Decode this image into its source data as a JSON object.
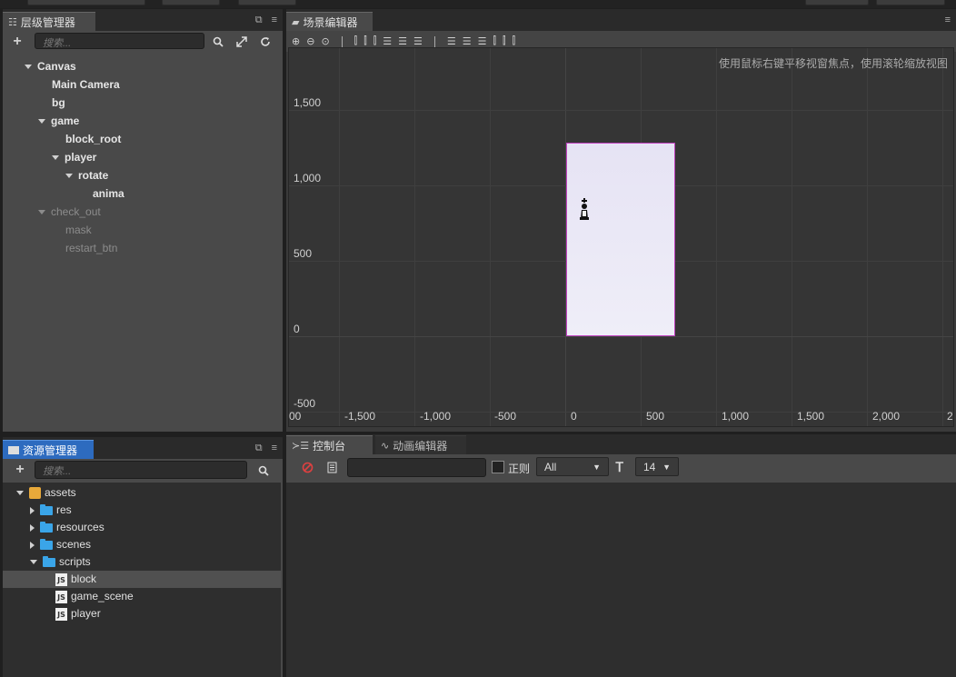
{
  "hierarchy": {
    "title": "层级管理器",
    "search_placeholder": "搜索...",
    "nodes": [
      {
        "label": "Canvas",
        "expanded": true,
        "dim": false
      },
      {
        "label": "Main Camera",
        "dim": false
      },
      {
        "label": "bg",
        "dim": false
      },
      {
        "label": "game",
        "expanded": true,
        "dim": false
      },
      {
        "label": "block_root",
        "dim": false
      },
      {
        "label": "player",
        "expanded": true,
        "dim": false
      },
      {
        "label": "rotate",
        "expanded": true,
        "dim": false
      },
      {
        "label": "anima",
        "dim": false
      },
      {
        "label": "check_out",
        "expanded": true,
        "dim": true
      },
      {
        "label": "mask",
        "dim": true
      },
      {
        "label": "restart_btn",
        "dim": true
      }
    ]
  },
  "scene": {
    "title": "场景编辑器",
    "hint": "使用鼠标右键平移视窗焦点，使用滚轮缩放视图",
    "y_labels": [
      "1,500",
      "1,000",
      "500",
      "0",
      "-500"
    ],
    "x_labels": [
      "00",
      "-1,500",
      "-1,000",
      "-500",
      "0",
      "500",
      "1,000",
      "1,500",
      "2,000",
      "2"
    ],
    "canvas_color": "#e8e4f4",
    "canvas_border": "#c040c0"
  },
  "assets": {
    "title": "资源管理器",
    "search_placeholder": "搜索...",
    "root": "assets",
    "folders": [
      "res",
      "resources",
      "scenes",
      "scripts"
    ],
    "scripts": [
      "block",
      "game_scene",
      "player"
    ],
    "selected": "block",
    "js_badge": "JS"
  },
  "console": {
    "tab_label": "控制台",
    "anim_tab_label": "动画编辑器",
    "regex_label": "正则",
    "level_value": "All",
    "font_size_value": "14"
  },
  "colors": {
    "accent_tab": "#2d6bbf",
    "folder": "#3aa5e8",
    "error_icon": "#e04040"
  }
}
